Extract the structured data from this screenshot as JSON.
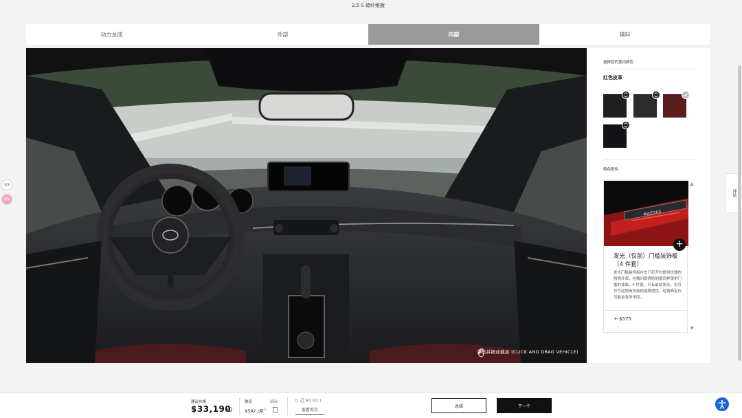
{
  "header": {
    "trim_title": "2.5 S 碳纤维版"
  },
  "tabs": [
    {
      "label": "动力总成",
      "active": false
    },
    {
      "label": "外部",
      "active": false
    },
    {
      "label": "内部",
      "active": true
    },
    {
      "label": "辅料",
      "active": false
    }
  ],
  "viewer": {
    "drag_hint": "单击并拖动载具 (CLICK AND DRAG VEHICLE)"
  },
  "panel": {
    "color_section_title": "选择您的室内颜色",
    "selected_color": "红色皮革",
    "swatches": [
      {
        "name": "black-leather",
        "color": "#1e1f21",
        "badge": "swap-icon"
      },
      {
        "name": "dark-leather",
        "color": "#2a2b2d",
        "badge": "swap-icon"
      },
      {
        "name": "red-leather",
        "color": "#5b1c1c",
        "badge": "check-icon"
      },
      {
        "name": "black-knit",
        "color": "#141416",
        "badge": "swap-icon"
      }
    ],
    "features_title": "特色配件",
    "accessory": {
      "name": "发光（仅前）门槛装饰板（4 件套）",
      "image_text": "MAZDA3",
      "description": "发光门槛装饰板在车门打开时提供优雅的照明外观。在微闪提供防划痕同样保护门槛的漆面。4 件套。只有前部发光。也可作为经销商安装的选择提供。经销商定价可能会有所不同。",
      "price": "+ $575"
    }
  },
  "sidebar_left": {
    "top_badge": "回顶",
    "icon_badge": "客服"
  },
  "sidebar_right": {
    "label": "评论"
  },
  "bottom": {
    "price_label": "建议价格",
    "price_value": "$33,190",
    "price_info": "i",
    "buy_label": "购买",
    "calc_label": "编辑",
    "monthly": "$592 /月",
    "monthly_sup": "§1",
    "zip_value": "0 近90001",
    "inventory_link": "查看库存",
    "summary_button": "总结",
    "next_button": "下一个"
  },
  "colors": {
    "accent": "#1565d8",
    "active_tab": "#9a9a9a",
    "red_leather": "#5b1c1c"
  }
}
